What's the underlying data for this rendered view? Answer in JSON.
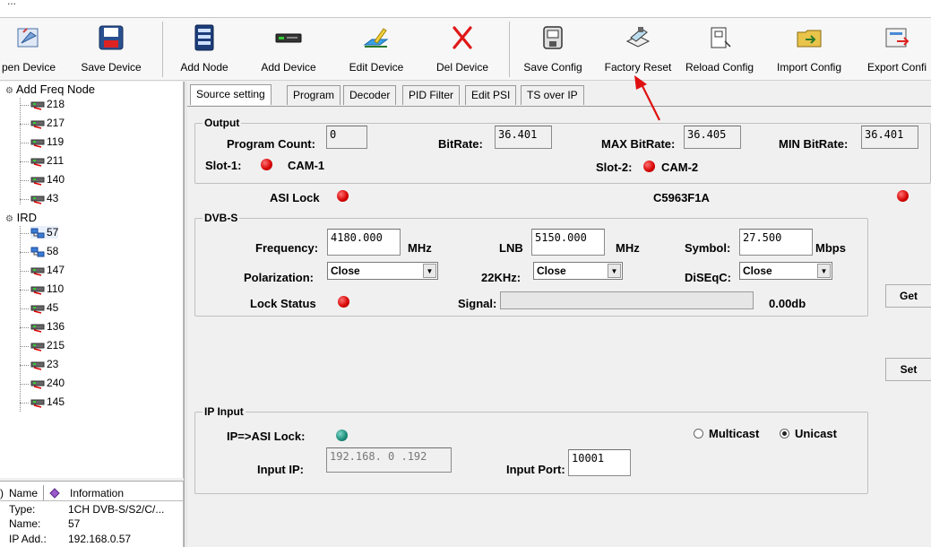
{
  "toolbar": {
    "buttons": [
      {
        "label": "pen Device",
        "icon": "open-device-icon"
      },
      {
        "label": "Save Device",
        "icon": "save-device-icon"
      },
      {
        "label": "Add Node",
        "icon": "add-node-icon"
      },
      {
        "label": "Add Device",
        "icon": "add-device-icon"
      },
      {
        "label": "Edit Device",
        "icon": "edit-device-icon"
      },
      {
        "label": "Del Device",
        "icon": "delete-device-icon"
      },
      {
        "label": "Save Config",
        "icon": "save-config-icon"
      },
      {
        "label": "Factory Reset",
        "icon": "factory-reset-icon"
      },
      {
        "label": "Reload Config",
        "icon": "reload-config-icon"
      },
      {
        "label": "Import Config",
        "icon": "import-config-icon"
      },
      {
        "label": "Export Confi",
        "icon": "export-config-icon"
      }
    ]
  },
  "tree": {
    "freq_root": "Add Freq Node",
    "freq_nodes": [
      "218",
      "217",
      "119",
      "211",
      "140",
      "43"
    ],
    "ird_root": "IRD",
    "ird_nodes": [
      "57",
      "58",
      "147",
      "110",
      "45",
      "136",
      "215",
      "23",
      "240",
      "145"
    ]
  },
  "props": {
    "col_name": "Name",
    "col_info": "Information",
    "rows": [
      {
        "k": "Type:",
        "v": "1CH DVB-S/S2/C/..."
      },
      {
        "k": "Name:",
        "v": "57"
      },
      {
        "k": "IP Add.:",
        "v": "192.168.0.57"
      }
    ]
  },
  "tabs": [
    "Source setting",
    "Program",
    "Decoder",
    "PID Filter",
    "Edit PSI",
    "TS over IP"
  ],
  "output": {
    "title": "Output",
    "program_count_label": "Program Count:",
    "program_count": "0",
    "bitrate_label": "BitRate:",
    "bitrate": "36.401",
    "max_bitrate_label": "MAX BitRate:",
    "max_bitrate": "36.405",
    "min_bitrate_label": "MIN BitRate:",
    "min_bitrate": "36.401",
    "slot1_label": "Slot-1:",
    "slot1_value": "CAM-1",
    "slot2_label": "Slot-2:",
    "slot2_value": "CAM-2"
  },
  "asi": {
    "label": "ASI Lock",
    "code": "C5963F1A"
  },
  "dvbs": {
    "title": "DVB-S",
    "frequency_label": "Frequency:",
    "frequency": "4180.000",
    "frequency_unit": "MHz",
    "lnb_label": "LNB",
    "lnb": "5150.000",
    "lnb_unit": "MHz",
    "symbol_label": "Symbol:",
    "symbol": "27.500",
    "symbol_unit": "Mbps",
    "polarization_label": "Polarization:",
    "polarization": "Close",
    "k22_label": "22KHz:",
    "k22": "Close",
    "diseqc_label": "DiSEqC:",
    "diseqc": "Close",
    "lock_status_label": "Lock Status",
    "signal_label": "Signal:",
    "signal_value": "0.00db"
  },
  "buttons": {
    "get": "Get",
    "set": "Set"
  },
  "ip_input": {
    "title": "IP Input",
    "ip_asi_lock_label": "IP=>ASI Lock:",
    "multicast_label": "Multicast",
    "unicast_label": "Unicast",
    "input_ip_label": "Input IP:",
    "input_ip": "192.168. 0 .192",
    "input_port_label": "Input Port:",
    "input_port": "10001"
  },
  "colors": {
    "led_red": "#d40000",
    "led_teal": "#1a8a78",
    "annotation_arrow": "#e01010"
  }
}
